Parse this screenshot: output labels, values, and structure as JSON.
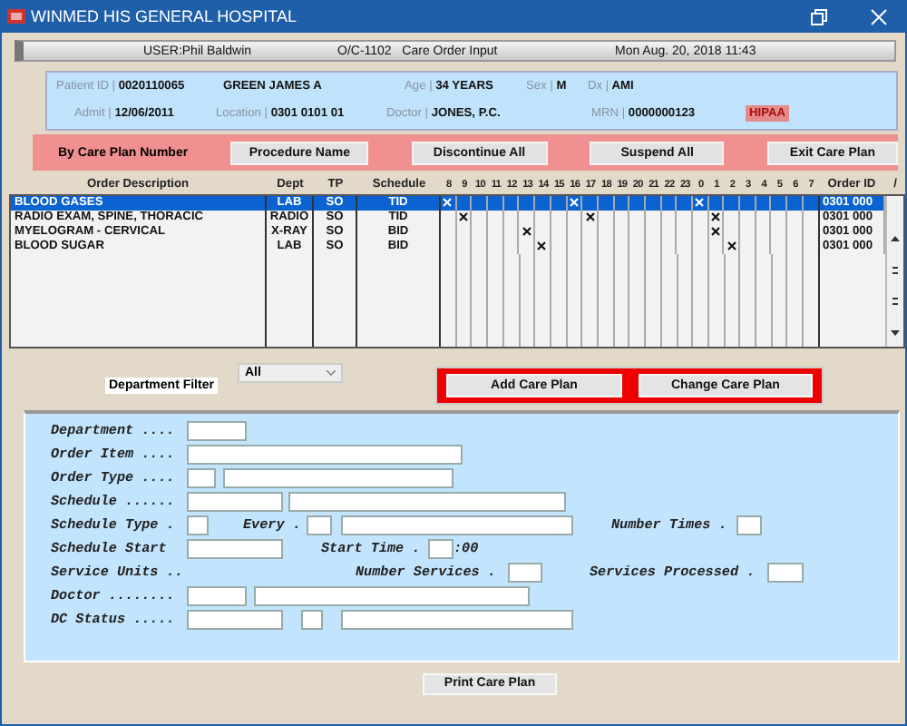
{
  "window": {
    "title": "WINMED HIS GENERAL HOSPITAL"
  },
  "header": {
    "user": "USER:Phil Baldwin",
    "screen": "O/C-1102   Care Order Input",
    "datetime": "Mon Aug. 20, 2018 11:43"
  },
  "patient": {
    "lines": [
      [
        {
          "kind": "field",
          "label": "Patient ID |",
          "value": "0020110065"
        },
        {
          "kind": "name",
          "value": "GREEN JAMES A"
        },
        {
          "kind": "field",
          "label": "Age |",
          "value": "34 YEARS"
        },
        {
          "kind": "field",
          "label": "Sex |",
          "value": "M"
        },
        {
          "kind": "field",
          "label": "Dx |",
          "value": "AMI"
        }
      ],
      [
        {
          "kind": "field",
          "label": "Admit |",
          "value": "12/06/2011"
        },
        {
          "kind": "field",
          "label": "Location |",
          "value": "0301 0101 01"
        },
        {
          "kind": "field",
          "label": "Doctor |",
          "value": "JONES, P.C."
        },
        {
          "kind": "field",
          "label": "MRN |",
          "value": "0000000123"
        },
        {
          "kind": "badge",
          "value": "HIPAA"
        }
      ]
    ]
  },
  "action_bar": {
    "sort_label": "By Care Plan Number",
    "buttons": [
      "Procedure Name",
      "Discontinue All",
      "Suspend All",
      "Exit Care Plan"
    ]
  },
  "orders": {
    "columns": [
      "Order Description",
      "Dept",
      "TP",
      "Schedule"
    ],
    "hours": [
      "8",
      "9",
      "10",
      "11",
      "12",
      "13",
      "14",
      "15",
      "16",
      "17",
      "18",
      "19",
      "20",
      "21",
      "22",
      "23",
      "0",
      "1",
      "2",
      "3",
      "4",
      "5",
      "6",
      "7"
    ],
    "id_column": "Order ID",
    "cut_column": "/",
    "rows": [
      {
        "description": "BLOOD GASES",
        "dept": "LAB",
        "tp": "SO",
        "schedule": "TID",
        "order_id": "0301 000",
        "selected": true,
        "hour_marks": [
          true,
          false,
          false,
          false,
          false,
          false,
          false,
          false,
          true,
          false,
          false,
          false,
          false,
          false,
          false,
          false,
          true,
          false,
          false,
          false,
          false,
          false,
          false,
          false
        ]
      },
      {
        "description": "RADIO EXAM, SPINE, THORACIC",
        "dept": "RADIO",
        "tp": "SO",
        "schedule": "TID",
        "order_id": "0301 000",
        "selected": false,
        "hour_marks": [
          false,
          true,
          false,
          false,
          false,
          false,
          false,
          false,
          false,
          true,
          false,
          false,
          false,
          false,
          false,
          false,
          false,
          true,
          false,
          false,
          false,
          false,
          false,
          false
        ]
      },
      {
        "description": "MYELOGRAM - CERVICAL",
        "dept": "X-RAY",
        "tp": "SO",
        "schedule": "BID",
        "order_id": "0301 000",
        "selected": false,
        "hour_marks": [
          false,
          false,
          false,
          false,
          false,
          true,
          false,
          false,
          false,
          false,
          false,
          false,
          false,
          false,
          false,
          false,
          false,
          true,
          false,
          false,
          false,
          false,
          false,
          false
        ]
      },
      {
        "description": "BLOOD SUGAR",
        "dept": "LAB",
        "tp": "SO",
        "schedule": "BID",
        "order_id": "0301 000",
        "selected": false,
        "hour_marks": [
          false,
          false,
          false,
          false,
          false,
          false,
          true,
          false,
          false,
          false,
          false,
          false,
          false,
          false,
          false,
          false,
          false,
          false,
          true,
          false,
          false,
          false,
          false,
          false
        ]
      }
    ]
  },
  "filter": {
    "label": "Department Filter",
    "value": "All"
  },
  "care_buttons": [
    "Add Care Plan",
    "Change Care Plan"
  ],
  "form": {
    "rows": [
      {
        "label": "Department ....",
        "controls": [
          {
            "kind": "field"
          }
        ]
      },
      {
        "label": "Order Item ....",
        "controls": [
          {
            "kind": "field"
          }
        ]
      },
      {
        "label": "Order Type ....",
        "controls": [
          {
            "kind": "field"
          },
          {
            "kind": "field"
          }
        ]
      },
      {
        "label": "Schedule ......",
        "controls": [
          {
            "kind": "field"
          },
          {
            "kind": "field"
          }
        ]
      },
      {
        "label": "Schedule Type .",
        "controls": [
          {
            "kind": "field"
          },
          {
            "kind": "label",
            "text": "Every ."
          },
          {
            "kind": "field"
          },
          {
            "kind": "field"
          },
          {
            "kind": "label",
            "text": "Number Times ."
          },
          {
            "kind": "field"
          }
        ]
      },
      {
        "label": "Schedule Start",
        "controls": [
          {
            "kind": "field"
          },
          {
            "kind": "label",
            "text": "Start Time ."
          },
          {
            "kind": "field"
          },
          {
            "kind": "suffix",
            "text": ":00"
          }
        ]
      },
      {
        "label": "Service Units ..",
        "controls": [
          {
            "kind": "label",
            "text": "Number Services ."
          },
          {
            "kind": "field"
          },
          {
            "kind": "label",
            "text": "Services Processed ."
          },
          {
            "kind": "field"
          }
        ]
      },
      {
        "label": "Doctor ........",
        "controls": [
          {
            "kind": "field"
          },
          {
            "kind": "field"
          }
        ]
      },
      {
        "label": "DC Status .....",
        "controls": [
          {
            "kind": "field"
          },
          {
            "kind": "field"
          },
          {
            "kind": "field"
          }
        ]
      }
    ]
  },
  "print_button": "Print Care Plan"
}
